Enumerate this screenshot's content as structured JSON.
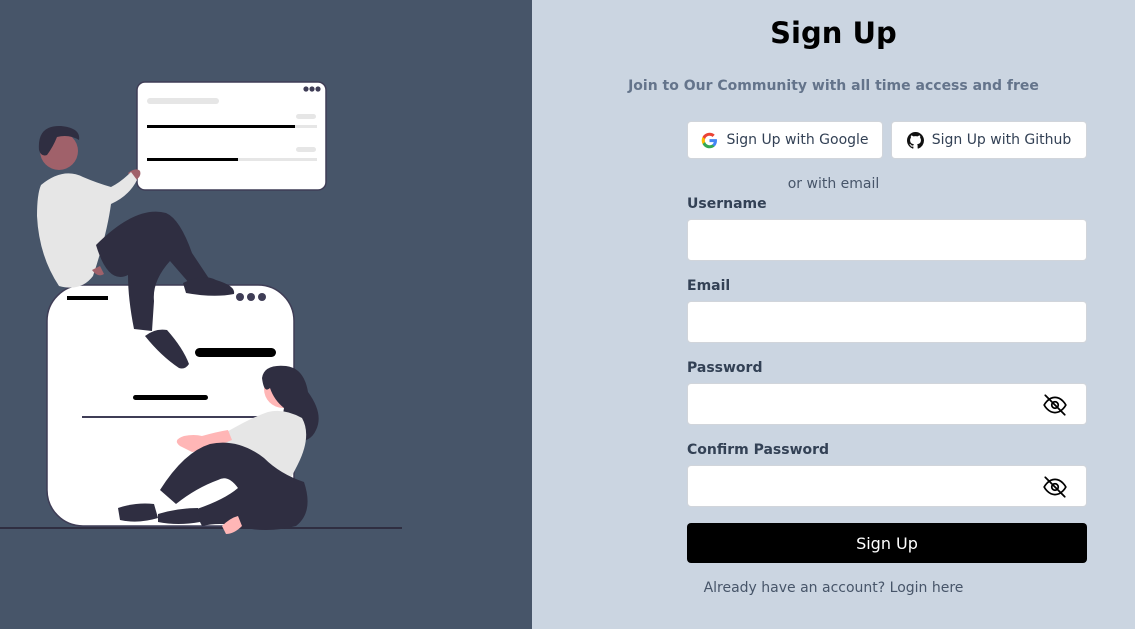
{
  "signup": {
    "title": "Sign Up",
    "subtitle": "Join to Our Community with all time access and free",
    "google_label": "Sign Up with Google",
    "github_label": "Sign Up with Github",
    "divider": "or with email",
    "username_label": "Username",
    "username_value": "",
    "email_label": "Email",
    "email_value": "",
    "password_label": "Password",
    "password_value": "",
    "confirm_label": "Confirm Password",
    "confirm_value": "",
    "submit_label": "Sign Up",
    "login_text": "Already have an account? Login here"
  },
  "icons": {
    "google": "google-icon",
    "github": "github-icon",
    "eye_off": "eye-off-icon"
  },
  "colors": {
    "left_bg": "#475569",
    "right_bg": "#cbd5e1",
    "button_dark": "#000000",
    "muted_text": "#64748b"
  }
}
